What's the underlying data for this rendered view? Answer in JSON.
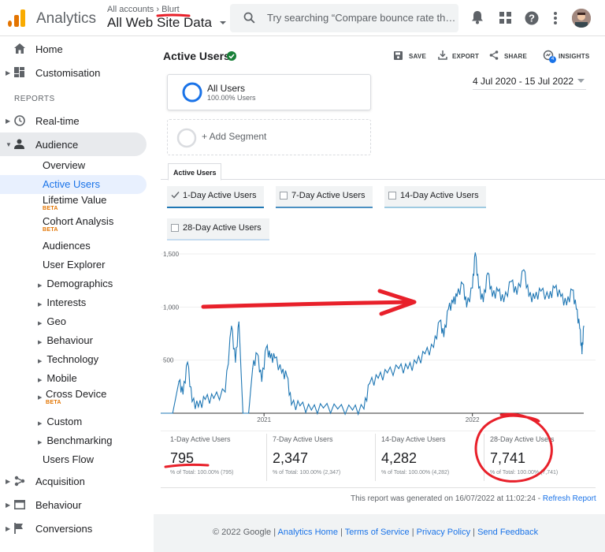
{
  "app": {
    "title": "Analytics",
    "breadcrumb_accounts": "All accounts",
    "breadcrumb_sep": "›",
    "breadcrumb_account": "Blurt",
    "property": "All Web Site Data",
    "search_placeholder": "Try searching “Compare bounce rate th…"
  },
  "sidebar": {
    "home": "Home",
    "customisation": "Customisation",
    "reports_header": "REPORTS",
    "realtime": "Real-time",
    "audience": "Audience",
    "audience_items": {
      "overview": "Overview",
      "active_users": "Active Users",
      "lifetime_value": "Lifetime Value",
      "lifetime_beta": "BETA",
      "cohort": "Cohort Analysis",
      "cohort_beta": "BETA",
      "audiences": "Audiences",
      "user_explorer": "User Explorer",
      "demographics": "Demographics",
      "interests": "Interests",
      "geo": "Geo",
      "behaviour": "Behaviour",
      "technology": "Technology",
      "mobile": "Mobile",
      "cross_device": "Cross Device",
      "cross_beta": "BETA",
      "custom": "Custom",
      "benchmarking": "Benchmarking",
      "users_flow": "Users Flow"
    },
    "acquisition": "Acquisition",
    "behaviour": "Behaviour",
    "conversions": "Conversions"
  },
  "report": {
    "title": "Active Users",
    "save": "SAVE",
    "export": "EXPORT",
    "share": "SHARE",
    "insights": "INSIGHTS",
    "insights_badge": "4",
    "date_range": "4 Jul 2020 - 15 Jul 2022",
    "segment_name": "All Users",
    "segment_pct": "100.00% Users",
    "add_segment": "+ Add Segment",
    "tab": "Active Users",
    "metrics": [
      "1-Day Active Users",
      "7-Day Active Users",
      "14-Day Active Users",
      "28-Day Active Users"
    ]
  },
  "chart_data": {
    "type": "line",
    "title": "",
    "xlabel": "",
    "ylabel": "",
    "x_range": [
      "2020-07-04",
      "2022-07-15"
    ],
    "x_ticks": [
      "2021",
      "2022"
    ],
    "y_ticks": [
      "1,500",
      "1,000",
      "500"
    ],
    "ylim": [
      0,
      1500
    ],
    "grid": true,
    "series": [
      {
        "name": "1-Day Active Users",
        "color": "#1f77b4",
        "points": [
          [
            "2020-07-04",
            0
          ],
          [
            "2020-07-25",
            0
          ],
          [
            "2020-08-05",
            300
          ],
          [
            "2020-08-12",
            180
          ],
          [
            "2020-08-20",
            480
          ],
          [
            "2020-08-28",
            110
          ],
          [
            "2020-09-08",
            60
          ],
          [
            "2020-09-20",
            130
          ],
          [
            "2020-10-05",
            140
          ],
          [
            "2020-10-25",
            200
          ],
          [
            "2020-11-05",
            820
          ],
          [
            "2020-11-12",
            480
          ],
          [
            "2020-11-18",
            860
          ],
          [
            "2020-11-25",
            0
          ],
          [
            "2020-12-05",
            0
          ],
          [
            "2020-12-12",
            420
          ],
          [
            "2020-12-20",
            560
          ],
          [
            "2020-12-28",
            300
          ],
          [
            "2021-01-05",
            620
          ],
          [
            "2021-01-12",
            520
          ],
          [
            "2021-01-20",
            520
          ],
          [
            "2021-02-01",
            380
          ],
          [
            "2021-02-10",
            350
          ],
          [
            "2021-02-18",
            80
          ],
          [
            "2021-03-05",
            70
          ],
          [
            "2021-03-25",
            30
          ],
          [
            "2021-04-15",
            50
          ],
          [
            "2021-05-10",
            40
          ],
          [
            "2021-06-05",
            30
          ],
          [
            "2021-06-25",
            40
          ],
          [
            "2021-07-05",
            280
          ],
          [
            "2021-07-20",
            330
          ],
          [
            "2021-08-05",
            380
          ],
          [
            "2021-08-25",
            420
          ],
          [
            "2021-09-10",
            420
          ],
          [
            "2021-09-25",
            470
          ],
          [
            "2021-10-10",
            560
          ],
          [
            "2021-10-25",
            620
          ],
          [
            "2021-11-05",
            870
          ],
          [
            "2021-11-12",
            720
          ],
          [
            "2021-11-20",
            980
          ],
          [
            "2021-11-28",
            1040
          ],
          [
            "2021-12-05",
            1100
          ],
          [
            "2021-12-15",
            1220
          ],
          [
            "2021-12-22",
            1000
          ],
          [
            "2022-01-01",
            1180
          ],
          [
            "2022-01-06",
            1510
          ],
          [
            "2022-01-12",
            1180
          ],
          [
            "2022-01-20",
            1050
          ],
          [
            "2022-01-28",
            1320
          ],
          [
            "2022-02-05",
            1100
          ],
          [
            "2022-02-15",
            1150
          ],
          [
            "2022-02-25",
            1050
          ],
          [
            "2022-03-10",
            1240
          ],
          [
            "2022-03-20",
            1120
          ],
          [
            "2022-04-01",
            1350
          ],
          [
            "2022-04-10",
            1100
          ],
          [
            "2022-04-20",
            1080
          ],
          [
            "2022-05-01",
            1150
          ],
          [
            "2022-05-15",
            1080
          ],
          [
            "2022-05-25",
            1180
          ],
          [
            "2022-06-05",
            1100
          ],
          [
            "2022-06-15",
            1020
          ],
          [
            "2022-06-25",
            1160
          ],
          [
            "2022-07-02",
            980
          ],
          [
            "2022-07-08",
            800
          ],
          [
            "2022-07-12",
            560
          ],
          [
            "2022-07-15",
            820
          ]
        ]
      }
    ]
  },
  "summary": [
    {
      "label": "1-Day Active Users",
      "value": "795",
      "sub": "% of Total: 100.00% (795)"
    },
    {
      "label": "7-Day Active Users",
      "value": "2,347",
      "sub": "% of Total: 100.00% (2,347)"
    },
    {
      "label": "14-Day Active Users",
      "value": "4,282",
      "sub": "% of Total: 100.00% (4,282)"
    },
    {
      "label": "28-Day Active Users",
      "value": "7,741",
      "sub": "% of Total: 100.00% (7,741)"
    }
  ],
  "footer": {
    "generated": "This report was generated on 16/07/2022 at 11:02:24 -",
    "refresh": "Refresh Report",
    "copyright": "© 2022 Google |",
    "links": [
      "Analytics Home",
      "Terms of Service",
      "Privacy Policy",
      "Send Feedback"
    ],
    "sep": "|"
  },
  "colors": {
    "accent": "#1a73e8",
    "series": "#1f77b4",
    "annotation": "#e8202a",
    "beta": "#e37400",
    "green_check": "#188038"
  }
}
